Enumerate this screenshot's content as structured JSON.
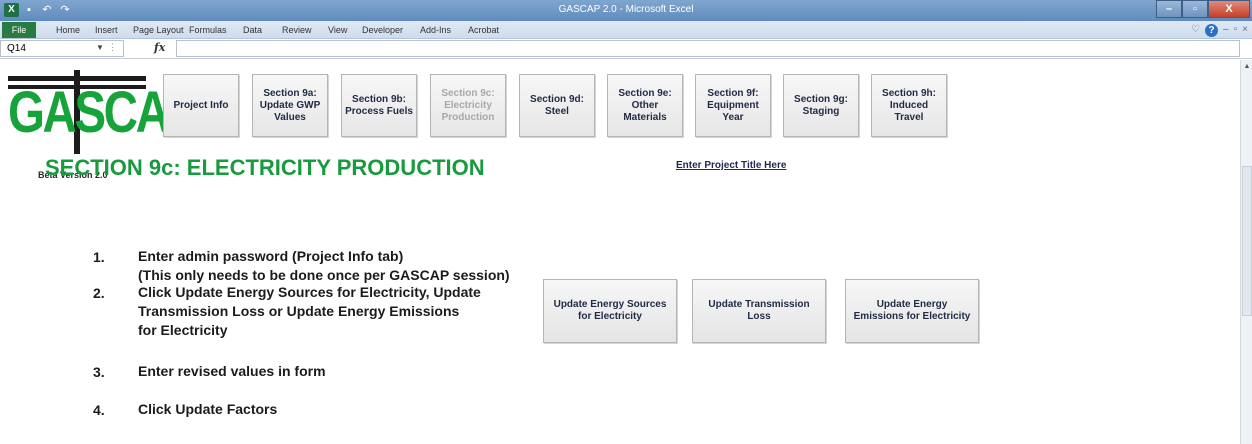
{
  "window": {
    "title": "GASCAP 2.0 - Microsoft Excel",
    "app_icon": "X",
    "qat_icons": [
      "save-icon",
      "undo-icon",
      "redo-icon"
    ],
    "controls": [
      "–",
      "▫",
      "X"
    ]
  },
  "ribbon": {
    "tabs": [
      "File",
      "Home",
      "Insert",
      "Page Layout",
      "Formulas",
      "Data",
      "Review",
      "View",
      "Developer",
      "Add-Ins",
      "Acrobat"
    ],
    "right_icons": [
      "♡",
      "?",
      "–",
      "▫",
      "×"
    ]
  },
  "formula_bar": {
    "name_box": "Q14",
    "fx": "fx",
    "formula": ""
  },
  "logo": {
    "text": "GASCAP",
    "subtitle": "Beta Version 2.0",
    "color": "#16a33a"
  },
  "nav_buttons": [
    {
      "label": "Project Info",
      "enabled": true
    },
    {
      "label": "Section 9a:\nUpdate GWP\nValues",
      "enabled": true
    },
    {
      "label": "Section 9b:\nProcess Fuels",
      "enabled": true
    },
    {
      "label": "Section 9c:\nElectricity\nProduction",
      "enabled": false
    },
    {
      "label": "Section 9d:\nSteel",
      "enabled": true
    },
    {
      "label": "Section 9e:\nOther\nMaterials",
      "enabled": true
    },
    {
      "label": "Section 9f:\nEquipment\nYear",
      "enabled": true
    },
    {
      "label": "Section 9g:\nStaging",
      "enabled": true
    },
    {
      "label": "Section 9h:\nInduced\nTravel",
      "enabled": true
    }
  ],
  "page": {
    "section_title": "SECTION 9c: ELECTRICITY PRODUCTION",
    "project_title_link": "Enter Project Title Here",
    "accent_color": "#1a9a3e"
  },
  "steps": [
    {
      "num": "1.",
      "text": "Enter admin password (Project Info tab)\n(This only needs to be done once per GASCAP session)"
    },
    {
      "num": "2.",
      "text": "Click Update Energy Sources for Electricity, Update\nTransmission Loss or Update Energy Emissions\nfor Electricity"
    },
    {
      "num": "3.",
      "text": "Enter revised values in form"
    },
    {
      "num": "4.",
      "text": "Click Update Factors"
    }
  ],
  "action_buttons": [
    {
      "label": "Update Energy Sources\nfor Electricity"
    },
    {
      "label": "Update Transmission\nLoss"
    },
    {
      "label": "Update Energy\nEmissions for Electricity"
    }
  ]
}
